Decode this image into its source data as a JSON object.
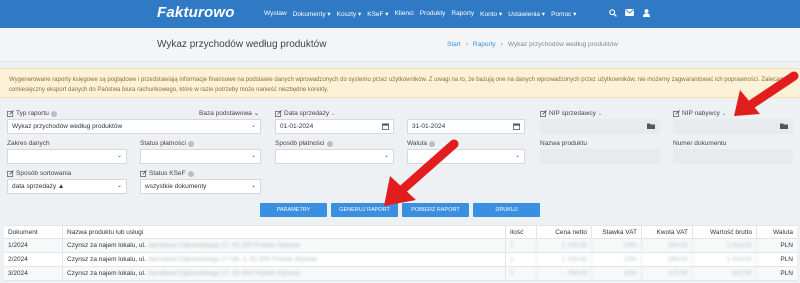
{
  "app": {
    "logo": "Fakturowo"
  },
  "nav": {
    "items": [
      "Wystaw",
      "Dokumenty ▾",
      "Koszty ▾",
      "KSeF ▾",
      "Klienci",
      "Produkty",
      "Raporty",
      "Konto ▾",
      "Ustawienia ▾",
      "Pomoc ▾"
    ],
    "icons": [
      "search-icon",
      "mail-icon",
      "user-icon"
    ]
  },
  "header": {
    "title": "Wykaz przychodów według produktów",
    "breadcrumb": [
      "Start",
      "›",
      "Raporty",
      "›",
      "Wykaz przychodów według produktów"
    ]
  },
  "notice": {
    "text": "Wygenerowane raporty księgowe są poglądowe i przedstawiają informacje finansowe na podstawie danych wprowadzonych do systemu przez użytkowników. Z uwagi na to, że bazują one na danych wprowadzonych przez użytkowników, nie możemy zagwarantować ich poprawności. Zalecamy comiesięczny eksport danych do Państwa biura rachunkowego, które w razie potrzeby może nanieść niezbędne korekty."
  },
  "filters": {
    "typ_raportu": {
      "label": "Typ raportu",
      "value": "Wykaz przychodów według produktów"
    },
    "baza": {
      "label": "Baza podstawowa"
    },
    "data_sprzedazy": {
      "label": "Data sprzedaży",
      "from": "01-01-2024",
      "to": "31-01-2024"
    },
    "nip_sprzedawcy": {
      "label": "NIP sprzedawcy",
      "value": ""
    },
    "nip_nabywcy": {
      "label": "NIP nabywcy",
      "value": ""
    },
    "zakres_danych": {
      "label": "Zakres danych",
      "value": ""
    },
    "status_platnosci": {
      "label": "Status płatności",
      "value": ""
    },
    "sposob_platnosci": {
      "label": "Sposób płatności",
      "value": ""
    },
    "waluta": {
      "label": "Waluta",
      "value": ""
    },
    "nazwa_produktu": {
      "label": "Nazwa produktu",
      "value": ""
    },
    "numer_dokumentu": {
      "label": "Numer dokumentu",
      "value": ""
    },
    "sposob_sortowania": {
      "label": "Sposób sortowania",
      "value": "data sprzedaży ▲"
    },
    "status_ksef": {
      "label": "Status KSeF",
      "value": "wszystkie dokumenty"
    }
  },
  "buttons": {
    "parametry": "PARAMETRY",
    "generuj": "GENERUJ RAPORT",
    "pobierz": "POBIERZ RAPORT",
    "drukuj": "DRUKUJ"
  },
  "table": {
    "headers": [
      "Dokument",
      "Nazwa produktu lub usługi",
      "Ilość",
      "Cena netto",
      "Stawka VAT",
      "Kwota VAT",
      "Wartość brutto",
      "Waluta"
    ],
    "rows": [
      {
        "doc": "1/2024",
        "name": "Czynsz za najem lokalu, ul.",
        "name_blur": "Jarosława Dąbrowskiego 17, 81-300 Polskie Stylowe",
        "qty": "1",
        "net": "1 150,00",
        "vat_rate": "23%",
        "vat": "264,50",
        "gross": "1 414,50",
        "cur": "PLN"
      },
      {
        "doc": "2/2024",
        "name": "Czynsz za najem lokalu, ul.",
        "name_blur": "Jarosława Dąbrowskiego 17 lok. 4, 81-300 Polskie Stylowe",
        "qty": "1",
        "net": "1 150,00",
        "vat_rate": "23%",
        "vat": "264,50",
        "gross": "1 414,50",
        "cur": "PLN"
      },
      {
        "doc": "3/2024",
        "name": "Czynsz za najem lokalu, ul.",
        "name_blur": "Jarosława Dąbrowskiego 17, 81-300 Polskie Stylowe",
        "qty": "1",
        "net": "750,00",
        "vat_rate": "23%",
        "vat": "172,50",
        "gross": "922,50",
        "cur": "PLN"
      }
    ]
  },
  "colors": {
    "topbar": "#3079c4",
    "button": "#3a8fe0",
    "notice_bg": "#fdf2d7",
    "arrow": "#e11d1d"
  }
}
